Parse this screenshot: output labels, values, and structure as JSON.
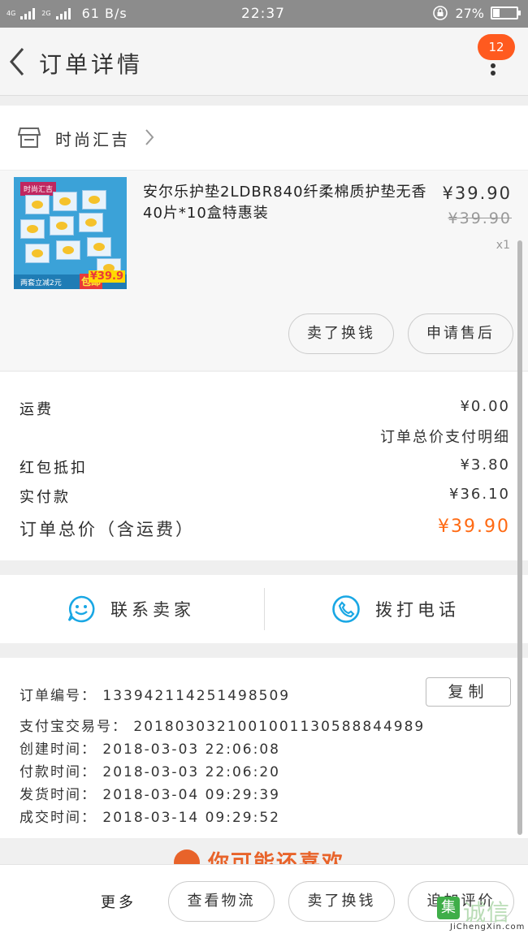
{
  "status_bar": {
    "network": "4G",
    "network2": "2G",
    "speed": "61 B/s",
    "time": "22:37",
    "battery": "27%",
    "battery_level": 0.27
  },
  "header": {
    "title": "订单详情",
    "badge": "12"
  },
  "shop": {
    "name": "时尚汇吉"
  },
  "product": {
    "title": "安尔乐护垫2LDBR840纤柔棉质护垫无香40片*10盒特惠装",
    "price": "¥39.90",
    "original_price": "¥39.90",
    "quantity": "x1",
    "thumb_brand": "时尚汇吉",
    "thumb_promo": "两套立减2元",
    "thumb_free": "包邮",
    "thumb_price": "¥39.9",
    "actions": {
      "refund": "卖了换钱",
      "after_sale": "申请售后"
    }
  },
  "fees": {
    "shipping_label": "运费",
    "shipping_value": "¥0.00",
    "detail_link": "订单总价支付明细",
    "coupon_label": "红包抵扣",
    "coupon_value": "¥3.80",
    "paid_label": "实付款",
    "paid_value": "¥36.10",
    "total_label": "订单总价（含运费）",
    "total_value": "¥39.90"
  },
  "contact": {
    "seller": "联系卖家",
    "call": "拨打电话"
  },
  "order_info": {
    "order_no": "订单编号：  1339421142514985​09",
    "alipay_no": "支付宝交易号：  2018030321001001130588844989",
    "created": "创建时间：  2018-03-03 22:06:08",
    "paid": "付款时间：  2018-03-03 22:06:20",
    "shipped": "发货时间：  2018-03-04 09:29:39",
    "completed": "成交时间：  2018-03-14 09:29:52",
    "copy": "复制"
  },
  "recommend": {
    "text": "你可能还喜欢"
  },
  "bottom_bar": {
    "more": "更多",
    "logistics": "查看物流",
    "sell": "卖了换钱",
    "review": "追加评价"
  },
  "watermark": {
    "cn": "诚信",
    "mark": "集",
    "en": "JiChengXin.com"
  },
  "colors": {
    "accent": "#ff6a13",
    "badge": "#ff5a1f",
    "icon_blue": "#19a7e4"
  }
}
